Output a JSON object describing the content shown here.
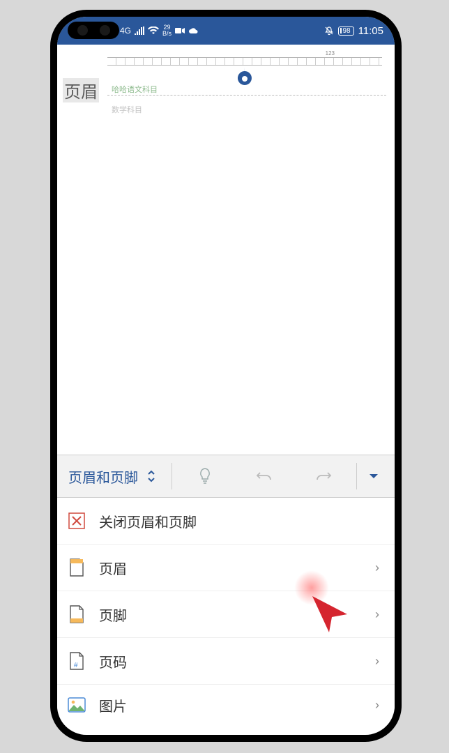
{
  "statusbar": {
    "network_type": "4G",
    "speed_top": "29",
    "speed_bottom": "B/s",
    "battery": "98",
    "time": "11:05"
  },
  "document": {
    "ruler_mark": "123",
    "header_label": "页眉",
    "line1": "哈哈语文科目",
    "line2": "数学科目"
  },
  "toolbar": {
    "title": "页眉和页脚"
  },
  "menu": {
    "close_label": "关闭页眉和页脚",
    "header_label": "页眉",
    "footer_label": "页脚",
    "pagenumber_label": "页码",
    "picture_label": "图片"
  }
}
